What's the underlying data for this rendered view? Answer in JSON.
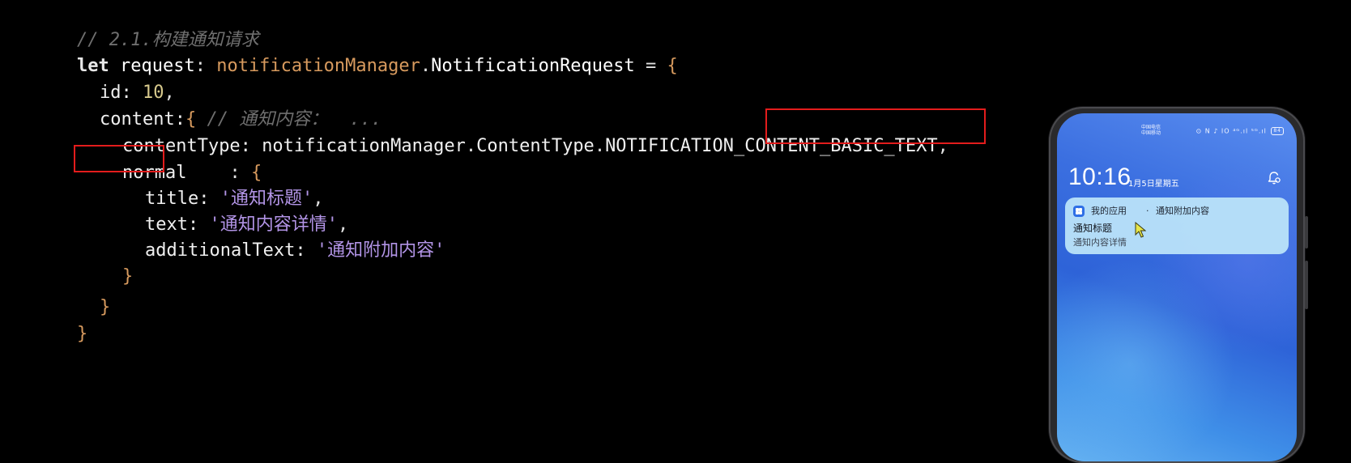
{
  "editor": {
    "line1": {
      "comment": "// 2.1.构建通知请求"
    },
    "line2": {
      "keyword": "let",
      "var": "request",
      "colon": ":",
      "ns": "notificationManager",
      "dot": ".",
      "type": "NotificationRequest",
      "eq": "=",
      "brace": "{"
    },
    "line3": {
      "key": "id:",
      "value": "10",
      "comma": ","
    },
    "line4": {
      "key": "content:",
      "brace": "{",
      "comment": "// 通知内容：  ..."
    },
    "line5": {
      "key": "contentType:",
      "ns": "notificationManager",
      "dot1": ".",
      "type": "ContentType",
      "dot2": ".",
      "prefix": "NOTIFICATION_",
      "highlighted": "CONTENT_BASIC_TEXT",
      "comma": ","
    },
    "line6": {
      "highlighted": "normal",
      "colon": ":",
      "brace": "{"
    },
    "line7": {
      "key": "title:",
      "value": "'通知标题'",
      "comma": ","
    },
    "line8": {
      "key": "text:",
      "value": "'通知内容详情'",
      "comma": ","
    },
    "line9": {
      "key": "additionalText:",
      "value": "'通知附加内容'"
    },
    "line10": {
      "brace": "}"
    },
    "line11": {
      "brace": "}"
    },
    "line12": {
      "brace": "}"
    },
    "highlight_color": "#e31c1c"
  },
  "phone": {
    "status": {
      "carrier1": "中国电信",
      "carrier2": "中国移动",
      "icons": "⊙ N ♪ ⅠO ⁴ᴳ.ıl ⁵ᴳ.ıl",
      "battery": "84"
    },
    "clock": "10:16",
    "date": "1月5日星期五",
    "bell_icon": "bell-settings-icon",
    "notification": {
      "app_name": "我的应用",
      "separator": "·",
      "additional_text": "通知附加内容",
      "title": "通知标题",
      "text": "通知内容详情"
    }
  }
}
